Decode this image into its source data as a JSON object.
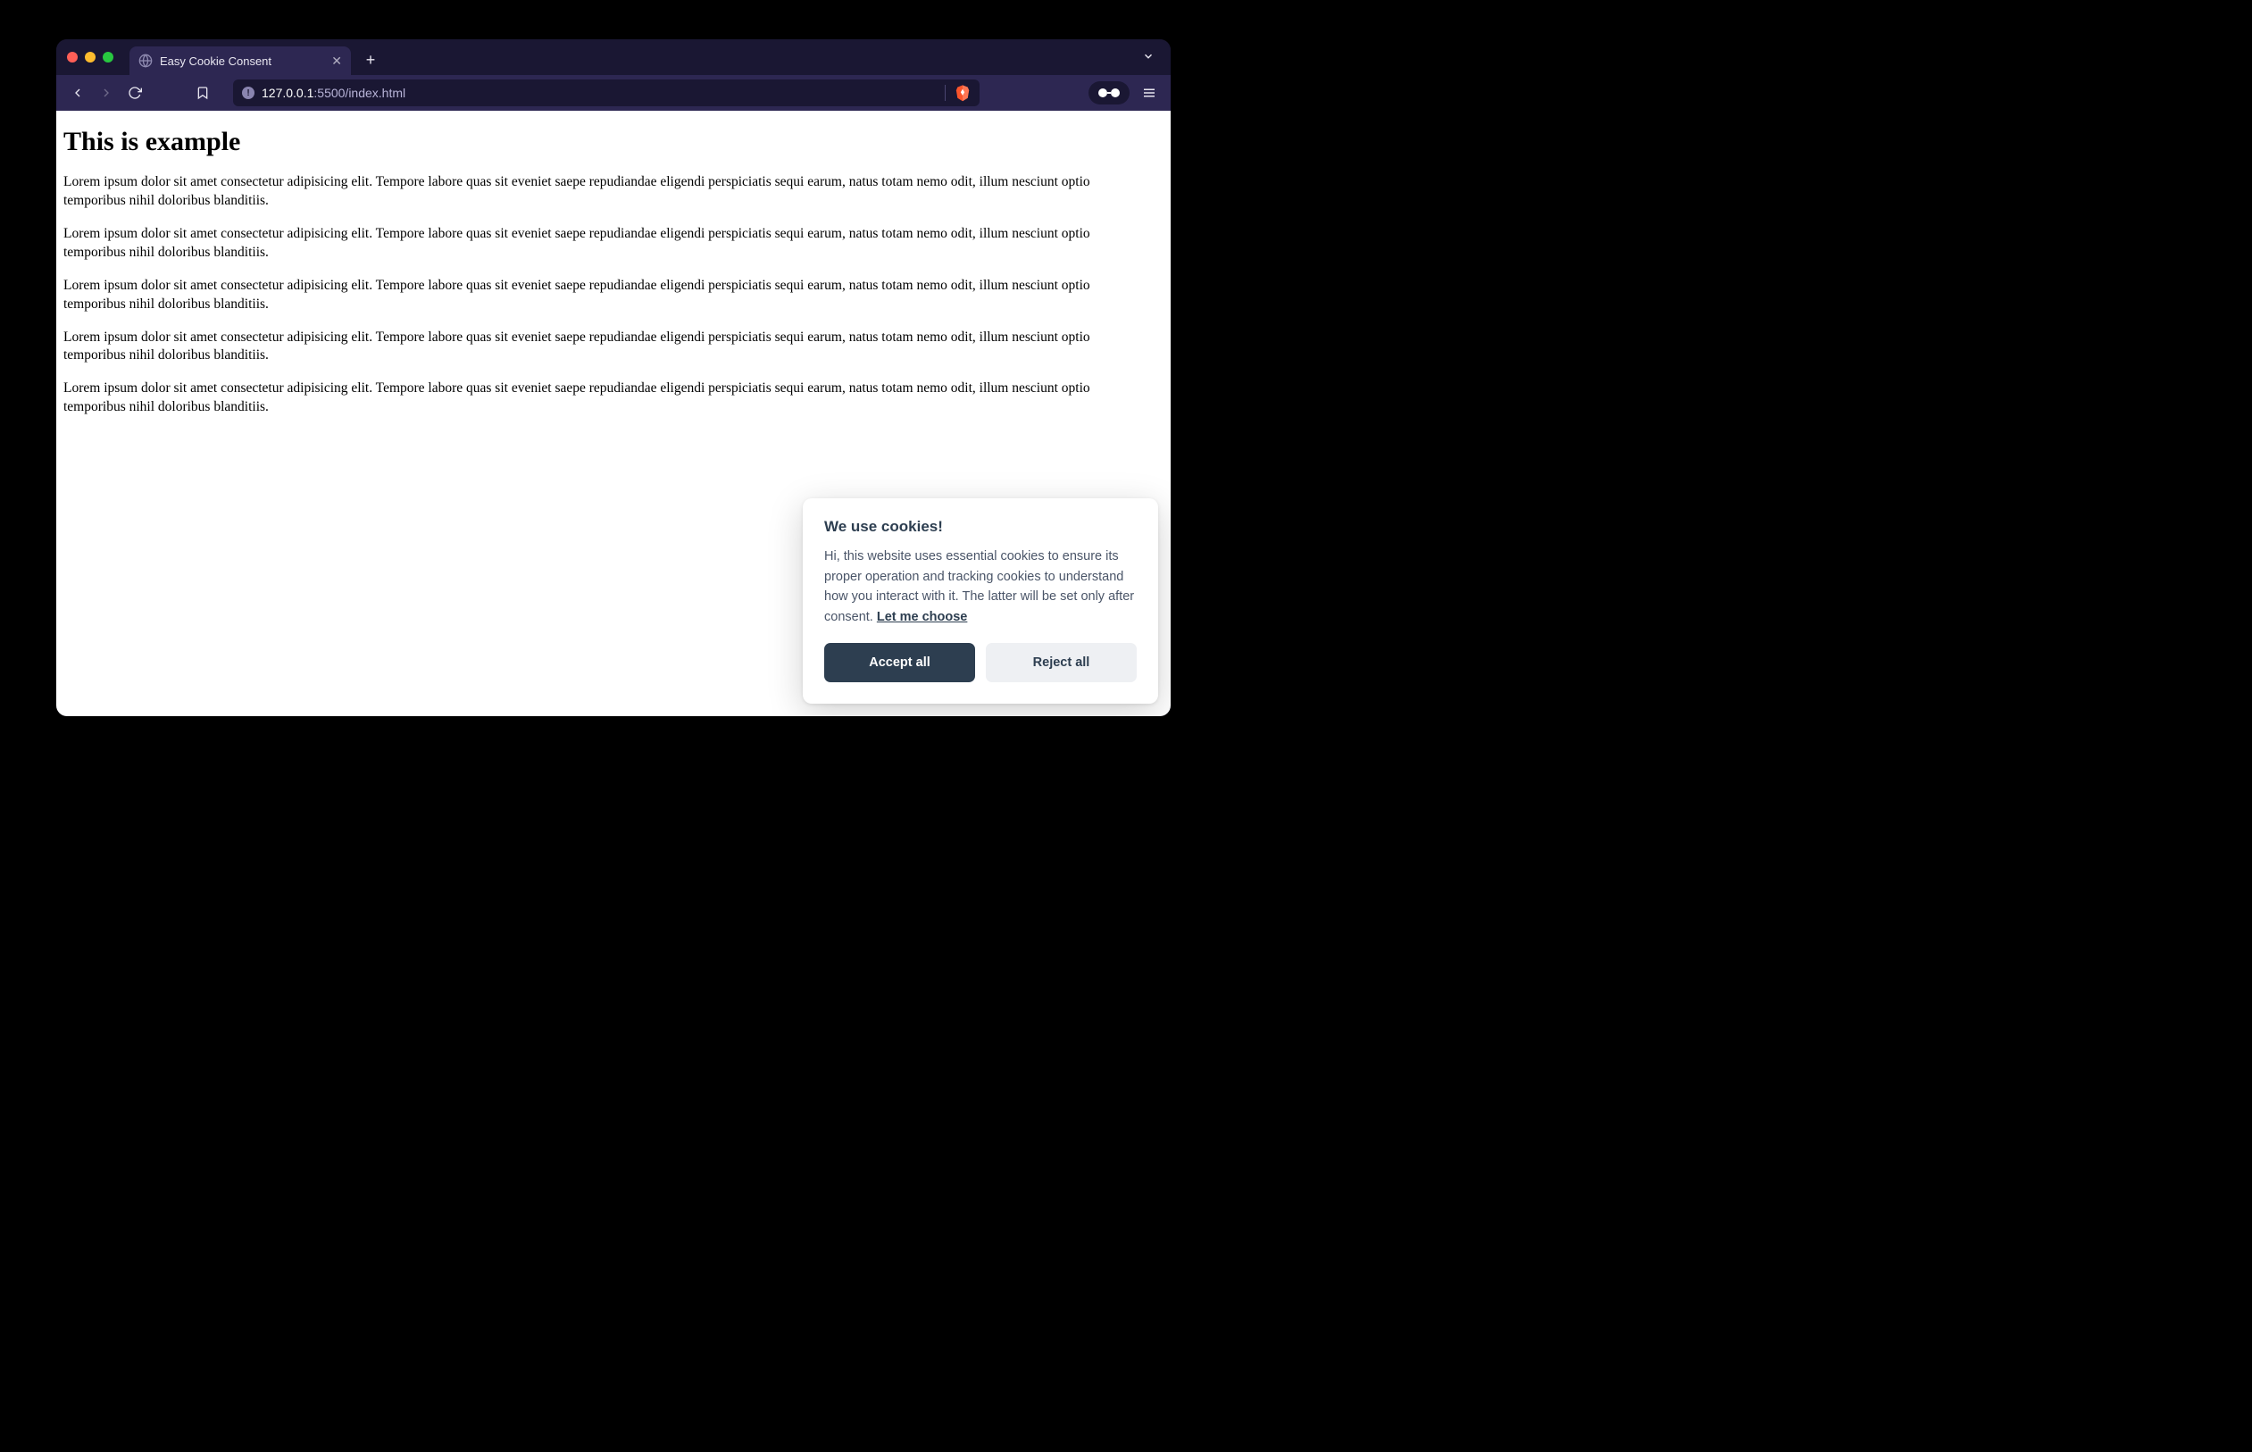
{
  "browser": {
    "tab_title": "Easy Cookie Consent",
    "url_host": "127.0.0.1",
    "url_path": ":5500/index.html"
  },
  "page": {
    "heading": "This is example",
    "paragraph": "Lorem ipsum dolor sit amet consectetur adipisicing elit. Tempore labore quas sit eveniet saepe repudiandae eligendi perspiciatis sequi earum, natus totam nemo odit, illum nesciunt optio temporibus nihil doloribus blanditiis."
  },
  "cookie": {
    "title": "We use cookies!",
    "body_text": "Hi, this website uses essential cookies to ensure its proper operation and tracking cookies to understand how you interact with it. The latter will be set only after consent. ",
    "link_label": "Let me choose",
    "accept_label": "Accept all",
    "reject_label": "Reject all"
  }
}
